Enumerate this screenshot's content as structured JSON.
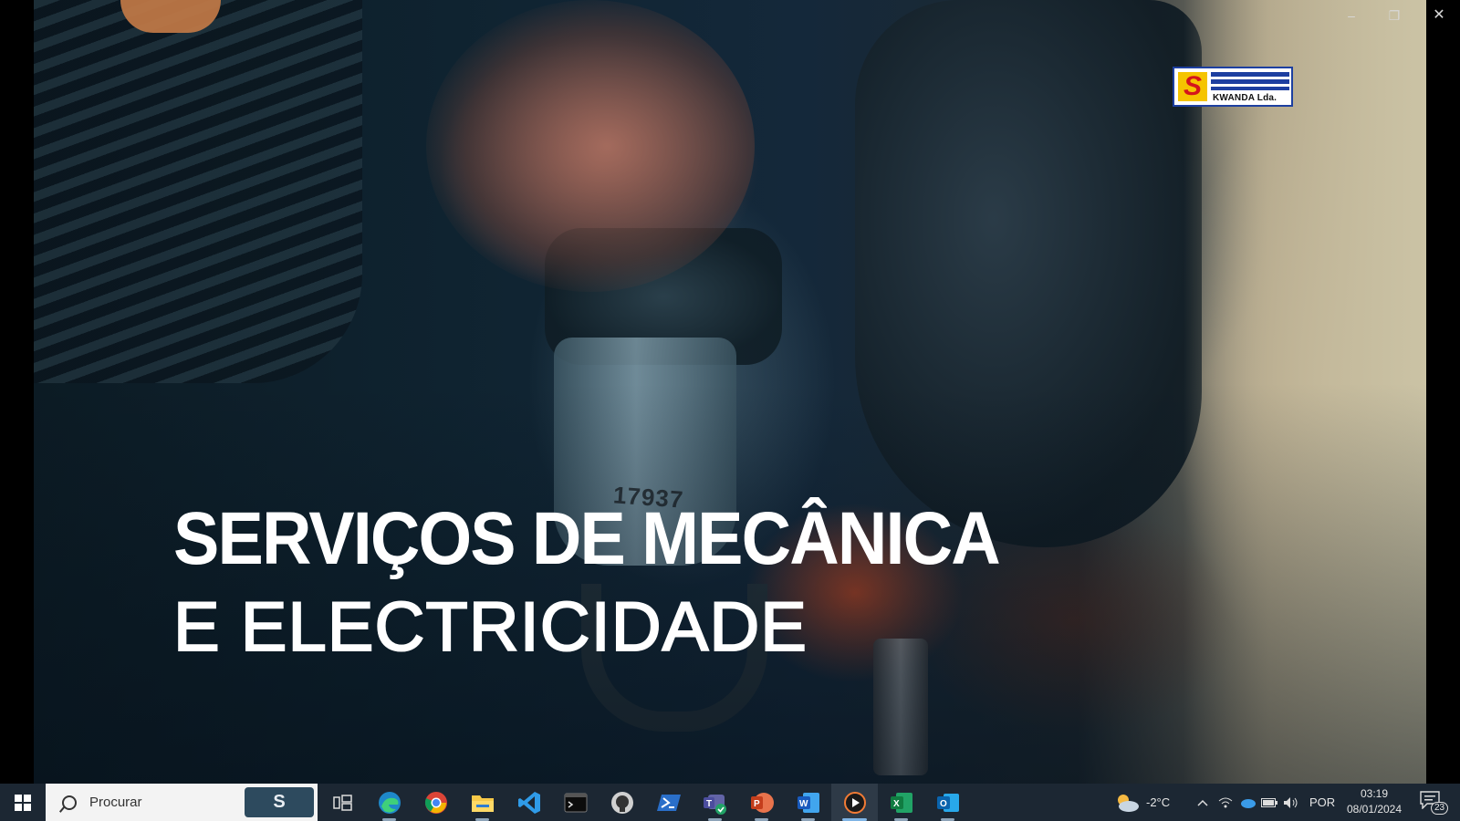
{
  "window": {
    "controls": {
      "minimize": "–",
      "maximize": "❐",
      "close": "✕"
    }
  },
  "video": {
    "headline_line1": "SERVIÇOS DE MECÂNICA",
    "headline_line2": "E ELECTRICIDADE",
    "part_number": "17937",
    "logo": {
      "letter": "S",
      "brand": "KWANDA Lda.",
      "colors": {
        "yellow": "#f5c400",
        "red": "#d4141c",
        "blue": "#1d3fa0"
      }
    }
  },
  "taskbar": {
    "search_placeholder": "Procurar",
    "search_highlight": "S",
    "apps": [
      {
        "name": "task-view",
        "icon": "task-view-icon",
        "state": "idle"
      },
      {
        "name": "edge",
        "icon": "edge-icon",
        "state": "running"
      },
      {
        "name": "chrome",
        "icon": "chrome-icon",
        "state": "idle"
      },
      {
        "name": "file-explorer",
        "icon": "folder-icon",
        "state": "running"
      },
      {
        "name": "vscode",
        "icon": "vscode-icon",
        "state": "idle"
      },
      {
        "name": "terminal",
        "icon": "terminal-icon",
        "state": "idle"
      },
      {
        "name": "github-desktop",
        "icon": "github-icon",
        "state": "idle"
      },
      {
        "name": "powershell",
        "icon": "powershell-icon",
        "state": "idle"
      },
      {
        "name": "teams",
        "icon": "teams-icon",
        "state": "running"
      },
      {
        "name": "powerpoint",
        "icon": "powerpoint-icon",
        "state": "running"
      },
      {
        "name": "word",
        "icon": "word-icon",
        "state": "running"
      },
      {
        "name": "media-player",
        "icon": "media-player-icon",
        "state": "active"
      },
      {
        "name": "excel",
        "icon": "excel-icon",
        "state": "running"
      },
      {
        "name": "outlook",
        "icon": "outlook-icon",
        "state": "running"
      }
    ],
    "tray": {
      "temperature": "-2°C",
      "language": "POR",
      "time": "03:19",
      "date": "08/01/2024",
      "notification_count": "23"
    }
  }
}
